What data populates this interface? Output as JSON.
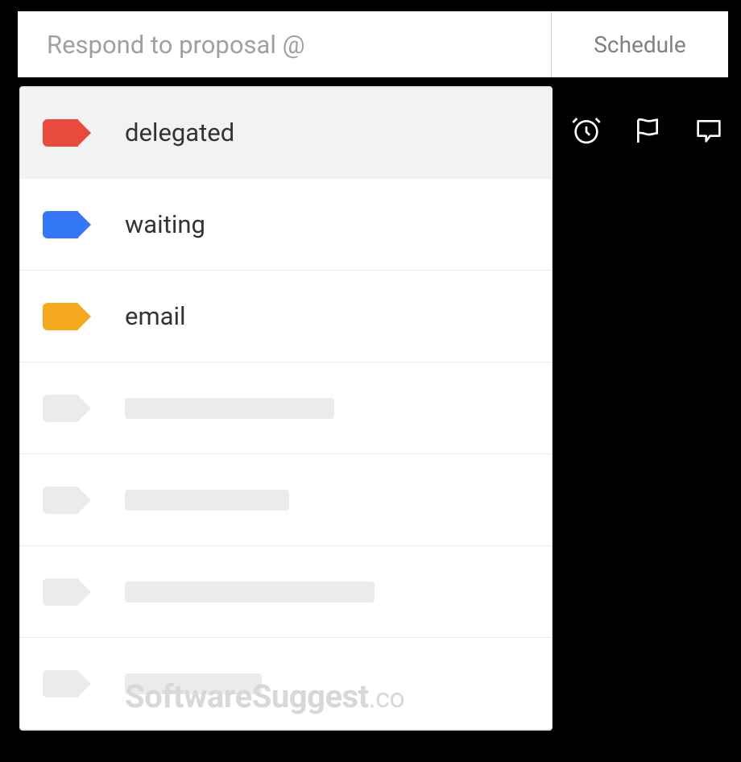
{
  "input": {
    "value": "Respond to proposal @",
    "placeholder": ""
  },
  "schedule": {
    "label": "Schedule"
  },
  "tags": [
    {
      "label": "delegated",
      "color": "red",
      "highlighted": true
    },
    {
      "label": "waiting",
      "color": "blue",
      "highlighted": false
    },
    {
      "label": "email",
      "color": "orange",
      "highlighted": false
    }
  ],
  "watermark": {
    "text": "SoftwareSuggest",
    "suffix": ".co"
  }
}
